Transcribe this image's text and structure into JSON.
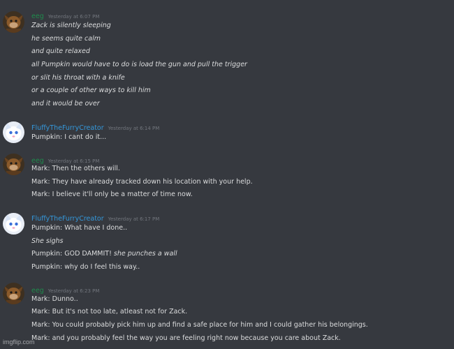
{
  "colors": {
    "background": "#36393f",
    "text": "#dcddde",
    "timestamp": "#72767d",
    "eeg_name": "#1f8b4c",
    "fluffy_name": "#3498db"
  },
  "groups": [
    {
      "avatar_icon": "brown-creature-avatar",
      "username": "eeg",
      "timestamp": "Yesterday at 6:07 PM",
      "lines": [
        {
          "text": "Zack is silently sleeping",
          "italic": true
        },
        {
          "text": "he seems quite calm",
          "italic": true
        },
        {
          "text": "and quite relaxed",
          "italic": true
        },
        {
          "text": "all Pumpkin would have to do is load the gun and pull the trigger",
          "italic": true
        },
        {
          "text": "or slit his throat with a knife",
          "italic": true
        },
        {
          "text": "or a couple of other ways to kill him",
          "italic": true
        },
        {
          "text": "and it would be over",
          "italic": true
        }
      ]
    },
    {
      "avatar_icon": "white-furry-avatar",
      "username": "FluffyTheFurryCreator",
      "timestamp": "Yesterday at 6:14 PM",
      "lines": [
        {
          "text": "Pumpkin: I cant do it..."
        }
      ]
    },
    {
      "avatar_icon": "brown-creature-avatar",
      "username": "eeg",
      "timestamp": "Yesterday at 6:15 PM",
      "lines": [
        {
          "text": "Mark: Then the others will."
        },
        {
          "text": "Mark: They have already tracked down his location with your help."
        },
        {
          "text": "Mark: I believe it'll only be a matter of time now."
        }
      ]
    },
    {
      "avatar_icon": "white-furry-avatar",
      "username": "FluffyTheFurryCreator",
      "timestamp": "Yesterday at 6:17 PM",
      "lines": [
        {
          "text": "Pumpkin: What have I done.."
        },
        {
          "text": "She sighs",
          "italic": true
        },
        {
          "text": "Pumpkin: GOD DAMMIT!",
          "em": "she punches a wall"
        },
        {
          "text": "Pumpkin: why do I feel this way.."
        }
      ]
    },
    {
      "avatar_icon": "brown-creature-avatar",
      "username": "eeg",
      "timestamp": "Yesterday at 6:23 PM",
      "lines": [
        {
          "text": "Mark: Dunno.."
        },
        {
          "text": "Mark: But it's not too late, atleast not for Zack."
        },
        {
          "text": "Mark: You could probably pick him up and find a safe place for him and I could gather his belongings."
        },
        {
          "text": "Mark: and you probably feel the way you are feeling right now because you care about Zack."
        }
      ]
    }
  ],
  "watermark": "imgflip.com"
}
